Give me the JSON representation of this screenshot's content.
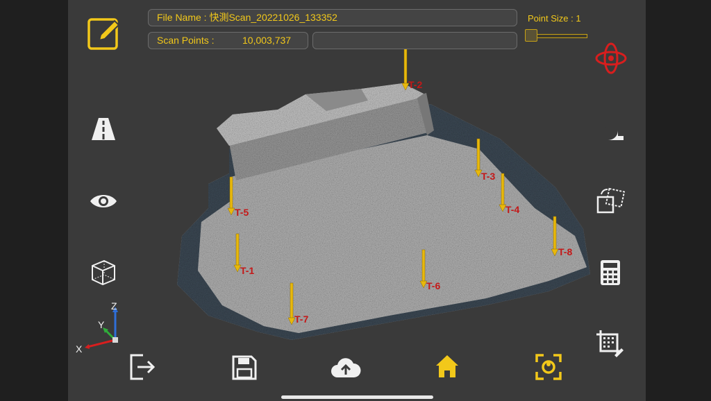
{
  "file": {
    "label": "File Name : 快測Scan_20221026_133352"
  },
  "scan": {
    "label": "Scan Points :",
    "value": "10,003,737"
  },
  "point_size": {
    "label": "Point Size :  1",
    "value": 1
  },
  "axes": {
    "x": "X",
    "y": "Y",
    "z": "Z"
  },
  "markers": [
    "T-1",
    "T-2",
    "T-3",
    "T-4",
    "T-5",
    "T-6",
    "T-7",
    "T-8"
  ],
  "colors": {
    "accent": "#f2c81a",
    "marker_label": "#c41818",
    "orbit_icon": "#d81e1e",
    "home_bar": "#e8e8e8"
  },
  "icons": {
    "left": [
      "edit-icon",
      "road-icon",
      "eye-icon",
      "cube-icon"
    ],
    "right": [
      "orbit-icon",
      "tape-measure-icon",
      "rotate-crop-icon",
      "calculator-icon",
      "crop-grid-icon"
    ],
    "bottom": [
      "exit-icon",
      "save-icon",
      "cloud-upload-icon",
      "home-icon",
      "face-scan-icon"
    ]
  }
}
